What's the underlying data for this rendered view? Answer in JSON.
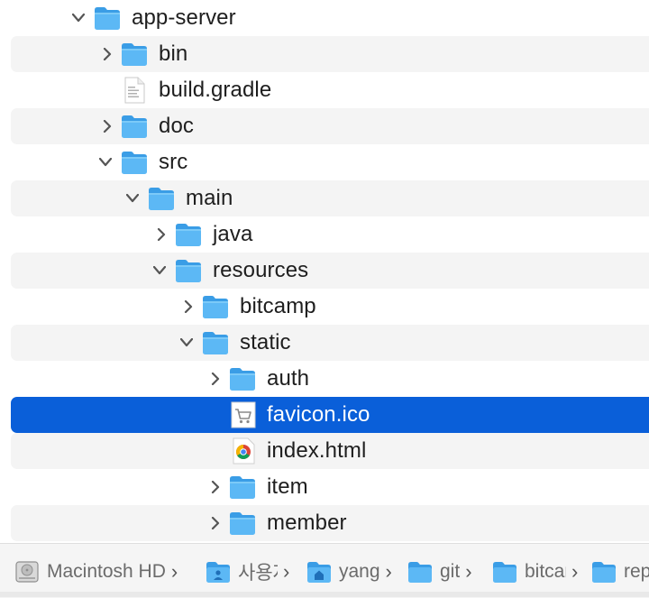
{
  "tree": [
    {
      "label": "app-server",
      "type": "folder",
      "expanded": true
    },
    {
      "label": "bin",
      "type": "folder",
      "expanded": false
    },
    {
      "label": "build.gradle",
      "type": "file",
      "icon": "document-icon"
    },
    {
      "label": "doc",
      "type": "folder",
      "expanded": false
    },
    {
      "label": "src",
      "type": "folder",
      "expanded": true
    },
    {
      "label": "main",
      "type": "folder",
      "expanded": true
    },
    {
      "label": "java",
      "type": "folder",
      "expanded": false
    },
    {
      "label": "resources",
      "type": "folder",
      "expanded": true
    },
    {
      "label": "bitcamp",
      "type": "folder",
      "expanded": false
    },
    {
      "label": "static",
      "type": "folder",
      "expanded": true
    },
    {
      "label": "auth",
      "type": "folder",
      "expanded": false
    },
    {
      "label": "favicon.ico",
      "type": "file",
      "icon": "cart-icon",
      "selected": true
    },
    {
      "label": "index.html",
      "type": "file",
      "icon": "chrome-icon"
    },
    {
      "label": "item",
      "type": "folder",
      "expanded": false
    },
    {
      "label": "member",
      "type": "folder",
      "expanded": false
    }
  ],
  "path_bar": [
    {
      "label": "Macintosh HD",
      "icon": "harddrive-icon"
    },
    {
      "label": "사용자",
      "icon": "users-folder-icon"
    },
    {
      "label": "yang",
      "icon": "home-folder-icon"
    },
    {
      "label": "git",
      "icon": "folder-icon"
    },
    {
      "label": "bitcamp",
      "icon": "folder-icon"
    },
    {
      "label": "rep",
      "icon": "folder-icon"
    }
  ],
  "colors": {
    "selection": "#0a5fd9",
    "alt_row": "#f4f4f4",
    "folder": "#5cb8f5",
    "text": "#1e1e1e"
  }
}
